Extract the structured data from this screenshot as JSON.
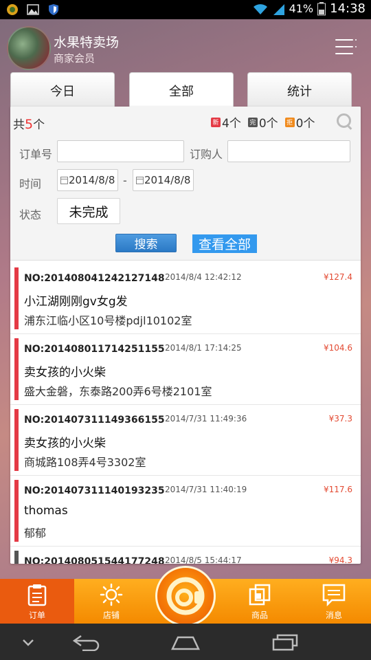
{
  "status_bar": {
    "battery": "41%",
    "time": "14:38"
  },
  "header": {
    "shop_name": "水果特卖场",
    "role": "商家会员"
  },
  "tabs": [
    {
      "label": "今日",
      "active": false
    },
    {
      "label": "全部",
      "active": true
    },
    {
      "label": "统计",
      "active": false
    }
  ],
  "summary": {
    "total_prefix": "共",
    "total_count": "5",
    "total_suffix": "个",
    "new_count": "4个",
    "done_count": "0个",
    "rejected_count": "0个",
    "badges": {
      "new": "新",
      "done": "完",
      "rejected": "拒"
    }
  },
  "filters": {
    "order_no_label": "订单号",
    "order_no_value": "",
    "buyer_label": "订购人",
    "buyer_value": "",
    "time_label": "时间",
    "date_from": "2014/8/8",
    "date_separator": "-",
    "date_to": "2014/8/8",
    "status_label": "状态",
    "status_value": "未完成",
    "search_button": "搜索",
    "view_all_button": "查看全部"
  },
  "orders": [
    {
      "no": "NO:201408041242127148",
      "time": "2014/8/4 12:42:12",
      "price": "¥127.4",
      "name": "小江湖刚刚gv女g发",
      "address": "浦东江临小区10号楼pdjl10102室"
    },
    {
      "no": "NO:201408011714251155",
      "time": "2014/8/1 17:14:25",
      "price": "¥104.6",
      "name": "卖女孩的小火柴",
      "address": "盛大金磐，东泰路200弄6号楼2101室"
    },
    {
      "no": "NO:201407311149366155",
      "time": "2014/7/31 11:49:36",
      "price": "¥37.3",
      "name": "卖女孩的小火柴",
      "address": "商城路108弄4号3302室"
    },
    {
      "no": "NO:201407311140193235",
      "time": "2014/7/31 11:40:19",
      "price": "¥117.6",
      "name": "thomas",
      "address": "郁郁"
    },
    {
      "no": "NO:201408051544177248",
      "time": "2014/8/5 15:44:17",
      "price": "¥94.3",
      "name": "",
      "address": ""
    }
  ],
  "bottom_nav": [
    {
      "label": "订单",
      "icon": "order-icon",
      "active": true
    },
    {
      "label": "店铺",
      "icon": "shop-icon",
      "active": false
    },
    {
      "label": "商品",
      "icon": "product-icon",
      "active": false
    },
    {
      "label": "消息",
      "icon": "message-icon",
      "active": false
    }
  ],
  "colors": {
    "accent": "#e43a45",
    "nav_orange": "#f99a10",
    "nav_active": "#ea5b0f",
    "link_blue": "#3399ee"
  }
}
